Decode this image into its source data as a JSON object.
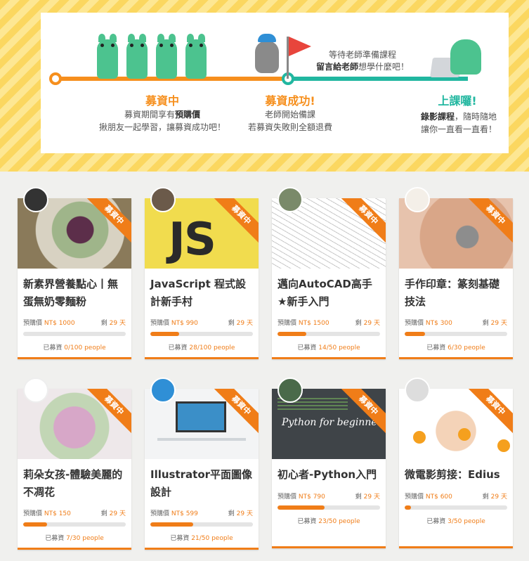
{
  "banner": {
    "stage1": {
      "title": "募資中",
      "line1_prefix": "募資期間享有",
      "line1_bold": "預購價",
      "line2": "揪朋友一起學習，讓募資成功吧！"
    },
    "stage2": {
      "title": "募資成功!",
      "line1": "老師開始備課",
      "line2": "若募資失敗則全額退費"
    },
    "await": {
      "line1": "等待老師準備課程",
      "line2_bold": "留言給老師",
      "line2_suffix": "想學什麼吧！"
    },
    "stage3": {
      "title": "上課囉!",
      "line1_bold": "錄影課程",
      "line1_suffix": "，隨時隨地",
      "line2": "讓你一直看一直看！"
    },
    "colors": {
      "orange": "#f68f1d",
      "green": "#21b7a0",
      "stripe": "#fbd760"
    }
  },
  "labels": {
    "ribbon": "募資中",
    "price_prefix": "預購價",
    "remaining_prefix": "剩",
    "days_suffix": "天",
    "raised_prefix": "已募資",
    "people_suffix": "people"
  },
  "courses": [
    {
      "title": "新素界營養點心丨無蛋無奶零麵粉",
      "price": "NT$ 1000",
      "days": "29",
      "raised": "0/100",
      "progress": 0.0
    },
    {
      "title": "JavaScript 程式設計新手村",
      "price": "NT$ 990",
      "days": "29",
      "raised": "28/100",
      "progress": 0.28
    },
    {
      "title": "邁向AutoCAD高手★新手入門",
      "price": "NT$ 1500",
      "days": "29",
      "raised": "14/50",
      "progress": 0.28
    },
    {
      "title": "手作印章：篆刻基礎技法",
      "price": "NT$ 300",
      "days": "29",
      "raised": "6/30",
      "progress": 0.2
    },
    {
      "title": "莉朵女孩-體驗美麗的不凋花",
      "price": "NT$ 150",
      "days": "29",
      "raised": "7/30",
      "progress": 0.233
    },
    {
      "title": "Illustrator平面圖像設計",
      "price": "NT$ 599",
      "days": "29",
      "raised": "21/50",
      "progress": 0.42
    },
    {
      "title": "初心者-Python入門",
      "price": "NT$ 790",
      "days": "29",
      "raised": "23/50",
      "progress": 0.46
    },
    {
      "title": "微電影剪接：Edius",
      "price": "NT$ 600",
      "days": "29",
      "raised": "3/50",
      "progress": 0.06
    }
  ],
  "thumb_text": {
    "js": "JS",
    "python": "Python for beginners"
  }
}
